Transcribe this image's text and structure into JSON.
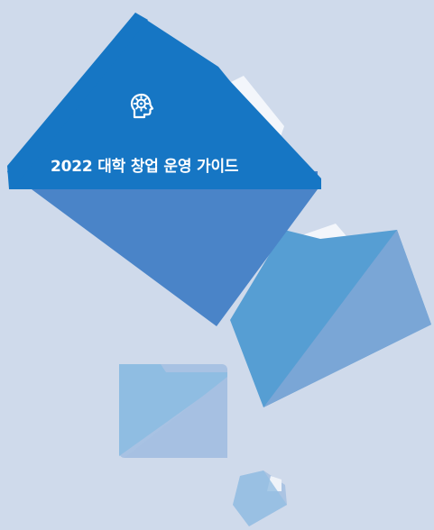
{
  "cover": {
    "title": "2022 대학 창업 운영 가이드"
  },
  "icons": {
    "main": "gear-head-icon"
  },
  "colors": {
    "background": "#cfdaeb",
    "folder_primary": "#1676c4",
    "folder_secondary": "#4a84c8",
    "folder_medium_a": "#569ed3",
    "folder_medium_b": "#7aa6d6",
    "folder_light_a": "#8fbde2",
    "folder_light_b": "#a8c2e3",
    "tab_white": "#f3f6fb"
  }
}
